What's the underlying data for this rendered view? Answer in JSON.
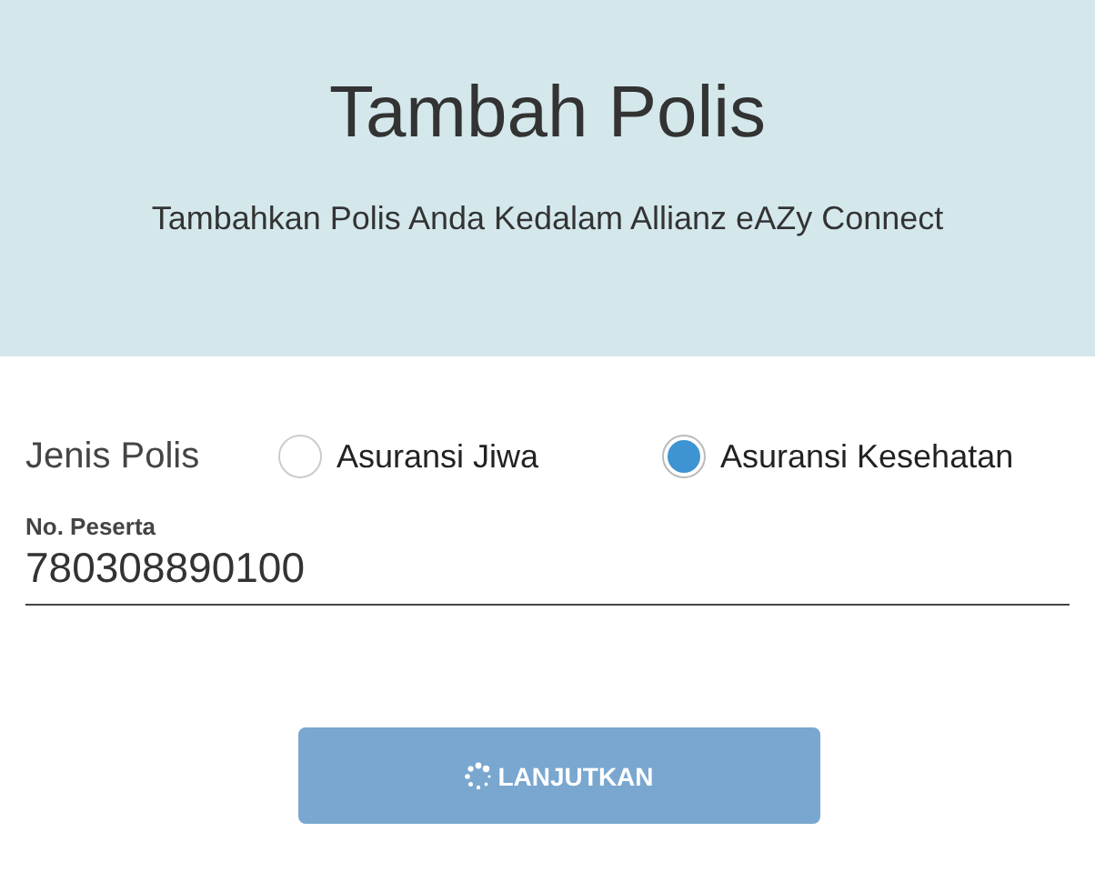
{
  "header": {
    "title": "Tambah Polis",
    "subtitle": "Tambahkan Polis Anda Kedalam Allianz eAZy Connect"
  },
  "policy_type": {
    "label": "Jenis Polis",
    "options": [
      {
        "label": "Asuransi Jiwa",
        "selected": false
      },
      {
        "label": "Asuransi Kesehatan",
        "selected": true
      }
    ]
  },
  "member_number": {
    "label": "No. Peserta",
    "value": "780308890100"
  },
  "submit": {
    "label": "LANJUTKAN",
    "loading": true
  }
}
